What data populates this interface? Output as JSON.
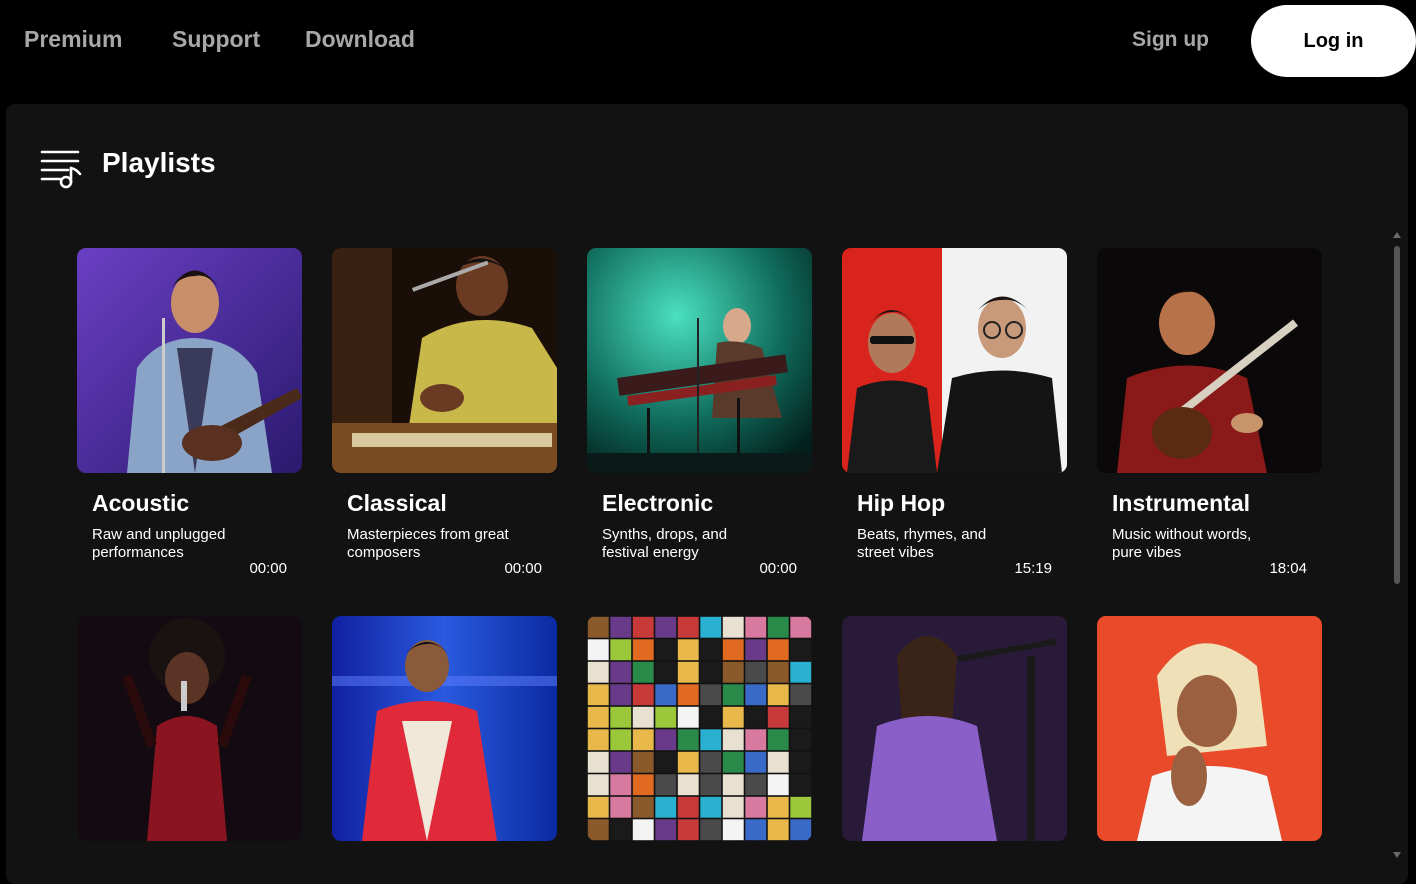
{
  "nav": {
    "premium": "Premium",
    "support": "Support",
    "download": "Download",
    "signup": "Sign up",
    "login": "Log in"
  },
  "panel": {
    "title": "Playlists",
    "icon": "playlist-music-icon"
  },
  "playlists": [
    {
      "title": "Acoustic",
      "description": "Raw and unplugged performances",
      "duration": "00:00",
      "image": "acoustic-singer-guitar"
    },
    {
      "title": "Classical",
      "description": "Masterpieces from great composers",
      "duration": "00:00",
      "image": "classical-vocalist-harmonium"
    },
    {
      "title": "Electronic",
      "description": "Synths, drops, and festival energy",
      "duration": "00:00",
      "image": "electronic-keyboard-stage"
    },
    {
      "title": "Hip Hop",
      "description": "Beats, rhymes, and street vibes",
      "duration": "15:19",
      "image": "hiphop-duo"
    },
    {
      "title": "Instrumental",
      "description": "Music without words, pure vibes",
      "duration": "18:04",
      "image": "instrumental-sitar"
    },
    {
      "title": "",
      "description": "",
      "duration": "",
      "image": "jazz-singer-red-dress"
    },
    {
      "title": "",
      "description": "",
      "duration": "",
      "image": "pop-singer-blue-stage"
    },
    {
      "title": "",
      "description": "",
      "duration": "",
      "image": "album-cover-grid"
    },
    {
      "title": "",
      "description": "",
      "duration": "",
      "image": "rock-singer-purple"
    },
    {
      "title": "",
      "description": "",
      "duration": "",
      "image": "rnb-singer-orange"
    }
  ],
  "colors": {
    "background": "#000000",
    "panel": "#121212",
    "nav_text": "#a7a7a7",
    "login_bg": "#ffffff"
  }
}
